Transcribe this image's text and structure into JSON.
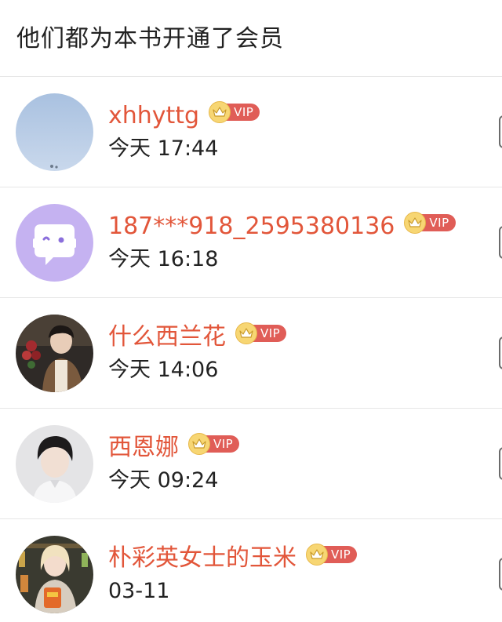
{
  "header": {
    "title": "他们都为本书开通了会员"
  },
  "vip_badge_label": "VIP",
  "members": [
    {
      "name": "xhhyttg",
      "time": "今天 17:44",
      "avatar": "sky-photo"
    },
    {
      "name": "187***918_2595380136",
      "time": "今天 16:18",
      "avatar": "default-chat-bubble"
    },
    {
      "name": "什么西兰花",
      "time": "今天 14:06",
      "avatar": "person-with-flowers-photo"
    },
    {
      "name": "西恩娜",
      "time": "今天 09:24",
      "avatar": "portrait-photo"
    },
    {
      "name": "朴彩英女士的玉米",
      "time": "03-11",
      "avatar": "person-with-snack-photo"
    }
  ],
  "colors": {
    "username": "#e2563a",
    "vip_label_bg": "#e05d57",
    "crown_badge": "#f7d673",
    "divider": "#e6e6e6"
  }
}
